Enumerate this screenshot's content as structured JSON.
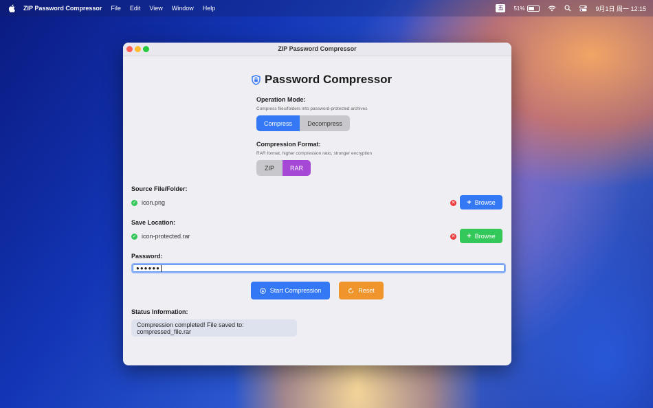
{
  "menubar": {
    "app_name": "ZIP Password Compressor",
    "menus": [
      "File",
      "Edit",
      "View",
      "Window",
      "Help"
    ],
    "input_indicator": "五",
    "battery_percent": "51%",
    "battery_level": 0.51,
    "datetime": "9月1日 周一  12:15"
  },
  "window": {
    "title": "ZIP Password Compressor"
  },
  "app": {
    "heading": "Password Compressor",
    "operation_mode": {
      "label": "Operation Mode:",
      "hint": "Compress files/folders into password-protected archives",
      "options": [
        "Compress",
        "Decompress"
      ],
      "selected": "Compress"
    },
    "format": {
      "label": "Compression Format:",
      "hint": "RAR format, higher compression ratio, stronger encryption",
      "options": [
        "ZIP",
        "RAR"
      ],
      "selected": "RAR"
    },
    "source": {
      "label": "Source File/Folder:",
      "value": "icon.png",
      "browse_label": "Browse"
    },
    "save": {
      "label": "Save Location:",
      "value": "icon-protected.rar",
      "browse_label": "Browse"
    },
    "password": {
      "label": "Password:",
      "masked_value": "●●●●●●"
    },
    "buttons": {
      "start": "Start Compression",
      "reset": "Reset"
    },
    "status": {
      "label": "Status Information:",
      "message": "Compression completed! File saved to: compressed_file.rar"
    }
  },
  "colors": {
    "accent_blue": "#3478f6",
    "accent_purple": "#a548d6",
    "accent_green": "#34c759",
    "accent_orange": "#f0952b",
    "danger_red": "#ef3b3b"
  }
}
